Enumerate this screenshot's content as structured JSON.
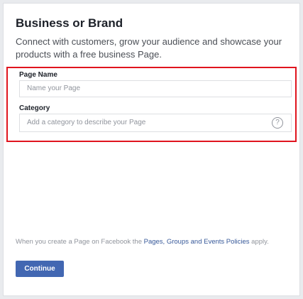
{
  "card": {
    "title": "Business or Brand",
    "description": "Connect with customers, grow your audience and showcase your products with a free business Page."
  },
  "form": {
    "page_name_label": "Page Name",
    "page_name_placeholder": "Name your Page",
    "category_label": "Category",
    "category_placeholder": "Add a category to describe your Page",
    "help_icon_glyph": "?"
  },
  "policy": {
    "prefix": "When you create a Page on Facebook the ",
    "link_text": "Pages, Groups and Events Policies",
    "suffix": " apply."
  },
  "actions": {
    "continue_label": "Continue"
  },
  "colors": {
    "accent": "#4267b2",
    "highlight_border": "#e0141e",
    "link": "#365899"
  }
}
